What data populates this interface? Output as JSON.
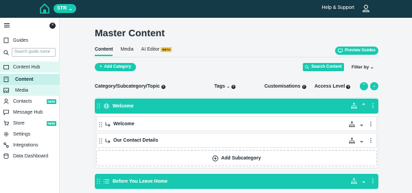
{
  "topbar": {
    "brand": "STR",
    "help": "Help & Support",
    "user_icon": "user-icon"
  },
  "sidebar": {
    "guides": "Guides",
    "search_placeholder": "Search guide name",
    "content_hub": "Content Hub",
    "content": "Content",
    "media": "Media",
    "contacts": "Contacts",
    "message_hub": "Message Hub",
    "store": "Store",
    "settings": "Settings",
    "integrations": "Integrations",
    "data_dashboard": "Data Dashboard",
    "new_badge": "NEW"
  },
  "main": {
    "title": "Master Content",
    "tabs": [
      "Content",
      "Media",
      "AI Editor"
    ],
    "beta": "BETA",
    "preview_guides": "Preview Guides",
    "add_category": "Add Category",
    "search_content": "Search Content",
    "filter_by": "Filter by",
    "columns": [
      "Category/Subcategory/Topic",
      "Tags",
      "Customisations",
      "Access Level"
    ],
    "rows": [
      "Welcome",
      "Welcome",
      "Our Contact Details",
      "Before You Leave Home"
    ],
    "add_subcategory": "Add Subcategory"
  },
  "colors": {
    "accent": "#17c9b0",
    "topbar": "#153a47"
  }
}
